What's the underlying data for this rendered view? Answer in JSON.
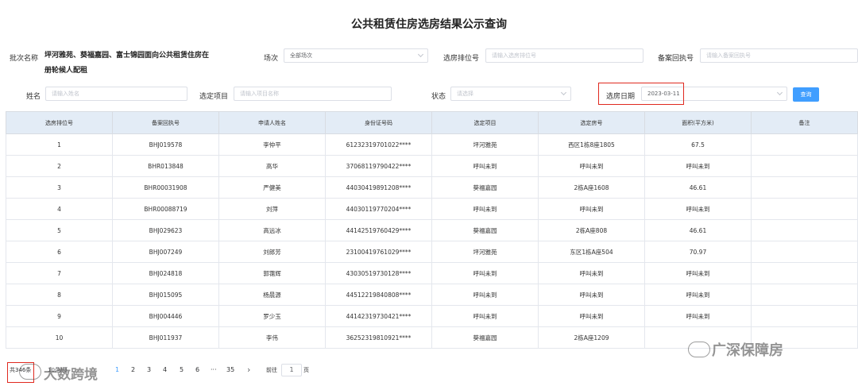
{
  "page": {
    "title": "公共租赁住房选房结果公示查询"
  },
  "filters": {
    "batch_label": "批次名称",
    "batch_value_line1": "坪河雅苑、葵福嘉园、富士锦园面向公共租赁住房在",
    "batch_value_line2": "册轮候人配租",
    "session_label": "场次",
    "session_value": "全部场次",
    "rank_label": "选房排位号",
    "rank_placeholder": "请输入选房排位号",
    "receipt_label": "备案回执号",
    "receipt_placeholder": "请输入备案回执号",
    "name_label": "姓名",
    "name_placeholder": "请输入姓名",
    "project_label": "选定项目",
    "project_placeholder": "请输入项目名称",
    "status_label": "状态",
    "status_placeholder": "请选择",
    "date_label": "选房日期",
    "date_value": "2023-03-11",
    "query_button": "查询"
  },
  "table": {
    "headers": [
      "选房排位号",
      "备案回执号",
      "申请人姓名",
      "身份证号码",
      "选定项目",
      "选定房号",
      "面积(平方米)",
      "备注"
    ],
    "rows": [
      [
        "1",
        "BHJ019578",
        "李仲平",
        "61232319701022****",
        "坪河雅苑",
        "西区1栋8座1805",
        "67.5",
        ""
      ],
      [
        "2",
        "BHR013848",
        "高华",
        "37068119790422****",
        "呼叫未到",
        "呼叫未到",
        "呼叫未到",
        ""
      ],
      [
        "3",
        "BHR00031908",
        "严健美",
        "44030419891208****",
        "葵福嘉园",
        "2栋A座1608",
        "46.61",
        ""
      ],
      [
        "4",
        "BHR00088719",
        "刘萍",
        "44030119770204****",
        "呼叫未到",
        "呼叫未到",
        "呼叫未到",
        ""
      ],
      [
        "5",
        "BHJ029623",
        "高远冰",
        "44142519760429****",
        "葵福嘉园",
        "2栋A座808",
        "46.61",
        ""
      ],
      [
        "6",
        "BHJ007249",
        "刘郎芳",
        "23100419761029****",
        "坪河雅苑",
        "东区1栋A座504",
        "70.97",
        ""
      ],
      [
        "7",
        "BHJ024818",
        "郭霭辉",
        "43030519730128****",
        "呼叫未到",
        "呼叫未到",
        "呼叫未到",
        ""
      ],
      [
        "8",
        "BHJ015095",
        "杨晨源",
        "44512219840808****",
        "呼叫未到",
        "呼叫未到",
        "呼叫未到",
        ""
      ],
      [
        "9",
        "BHJ004446",
        "罗少玉",
        "44142319730421****",
        "呼叫未到",
        "呼叫未到",
        "呼叫未到",
        ""
      ],
      [
        "10",
        "BHJ011937",
        "李伟",
        "36252319810921****",
        "葵福嘉园",
        "2栋A座1209",
        "",
        ""
      ]
    ]
  },
  "pagination": {
    "total": "共346条",
    "page_size": "10条/页",
    "pages": [
      "1",
      "2",
      "3",
      "4",
      "5",
      "6",
      "···",
      "35"
    ],
    "next": "›",
    "goto_label": "前往",
    "goto_value": "1",
    "goto_suffix": "页"
  },
  "watermarks": {
    "left": "大数跨境",
    "right": "广深保障房"
  }
}
